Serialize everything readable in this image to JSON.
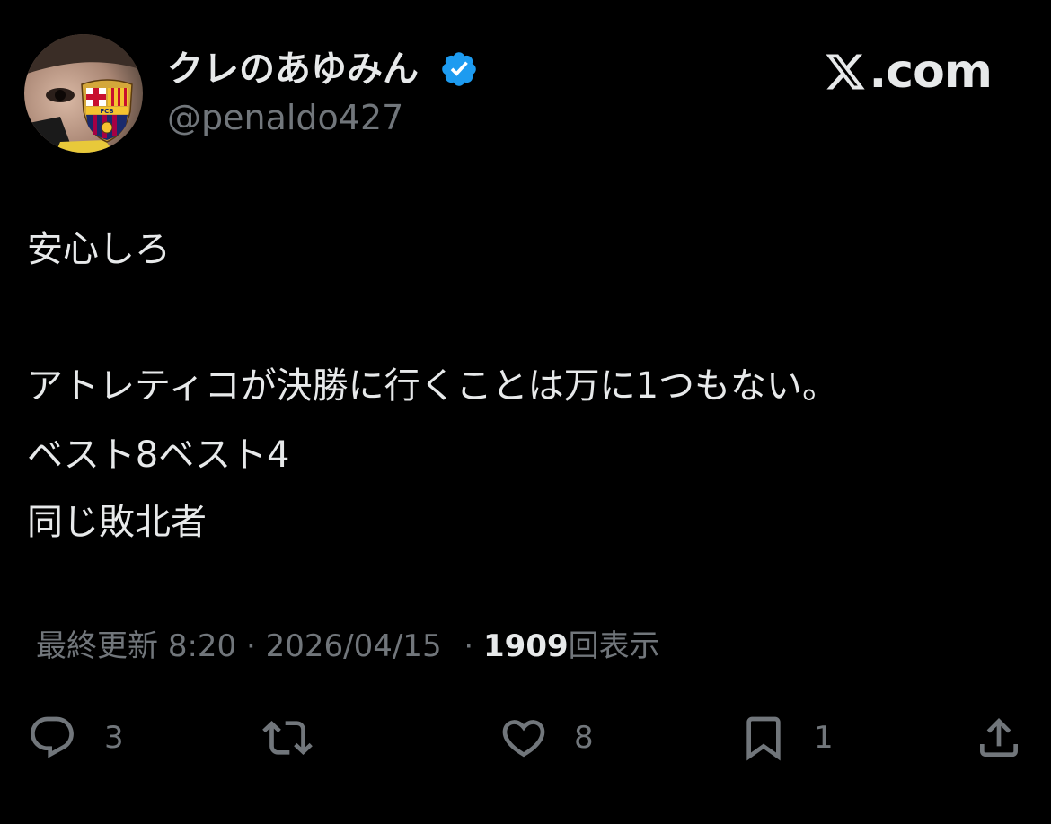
{
  "colors": {
    "background": "#000000",
    "primary_text": "#e7e9ea",
    "secondary_text": "#71767b",
    "verified_blue": "#1d9bf0"
  },
  "author": {
    "display_name": "クレのあゆみん",
    "handle": "@penaldo427",
    "verified": true,
    "avatar_icon": "avatar-fc-barcelona-crest"
  },
  "brand": {
    "logo_icon": "x-logo-icon",
    "domain": ".com"
  },
  "tweet": {
    "lines": [
      "安心しろ",
      "アトレティコが決勝に行くことは万に1つもない。",
      "ベスト8ベスト4",
      "同じ敗北者"
    ]
  },
  "meta": {
    "updated_label": "最終更新",
    "time": "8:20",
    "separator": "·",
    "date": "2026/04/15",
    "views_count": "1909",
    "views_label": "回表示"
  },
  "actions": {
    "reply": {
      "icon": "reply-icon",
      "count": "3"
    },
    "retweet": {
      "icon": "retweet-icon",
      "count": ""
    },
    "like": {
      "icon": "heart-icon",
      "count": "8"
    },
    "bookmark": {
      "icon": "bookmark-icon",
      "count": "1"
    },
    "share": {
      "icon": "share-icon",
      "count": ""
    }
  }
}
